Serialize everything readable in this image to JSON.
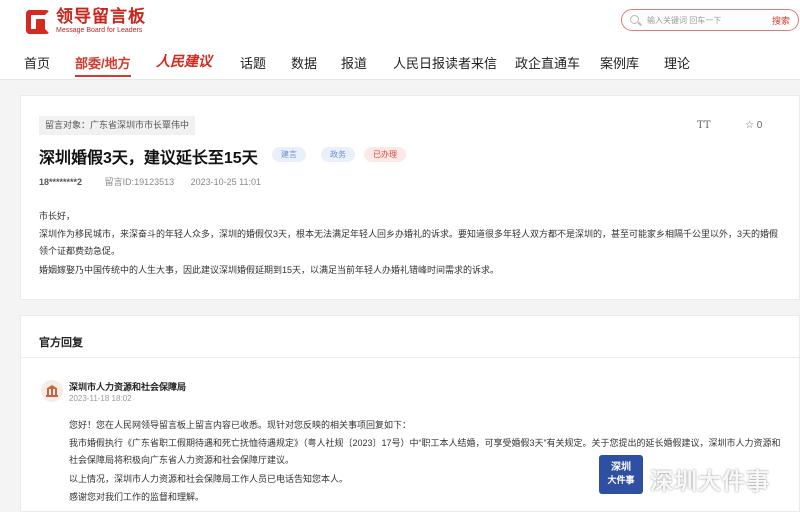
{
  "header": {
    "logo_title": "领导留言板",
    "logo_subtitle": "Message Board for Leaders",
    "search_placeholder": "输入关键词 回车一下",
    "search_button": "搜索"
  },
  "nav": {
    "items": [
      "首页",
      "部委/地方",
      "人民建议",
      "话题",
      "数据",
      "报道",
      "人民日报读者来信",
      "政企直通车",
      "案例库",
      "理论"
    ],
    "active_index": 1
  },
  "message": {
    "target": "留言对象：广东省深圳市市长覃伟中",
    "font_toggle": "TT",
    "star": "☆",
    "star_count": "0",
    "title": "深圳婚假3天，建议延长至15天",
    "tags": [
      "建言",
      "政务",
      "已办理"
    ],
    "author": "18********2",
    "message_id": "留言ID:19123513",
    "datetime": "2023-10-25 11:01",
    "paragraphs": [
      "市长好，",
      "深圳作为移民城市，来深奋斗的年轻人众多，深圳的婚假仅3天，根本无法满足年轻人回乡办婚礼的诉求。要知道很多年轻人双方都不是深圳的，甚至可能家乡相隔千公里以外，3天的婚假领个证都费劲急促。",
      "婚姻嫁娶乃中国传统中的人生大事，因此建议深圳婚假延期到15天，以满足当前年轻人办婚礼错峰时间需求的诉求。"
    ]
  },
  "reply": {
    "heading": "官方回复",
    "department": "深圳市人力资源和社会保障局",
    "datetime": "2023-11-18 18:02",
    "paragraphs": [
      "您好！您在人民网领导留言板上留言内容已收悉。现针对您反映的相关事项回复如下：",
      "我市婚假执行《广东省职工假期待遇和死亡抚恤待遇规定》（粤人社规〔2023〕17号）中“职工本人结婚，可享受婚假3天”有关规定。关于您提出的延长婚假建议，深圳市人力资源和社会保障局将积极向广东省人力资源和社会保障厅建议。",
      "以上情况，深圳市人力资源和社会保障局工作人员已电话告知您本人。",
      "感谢您对我们工作的监督和理解。"
    ]
  },
  "watermark": {
    "badge_line1": "深圳",
    "badge_line2": "大件事",
    "text": "深圳大件事"
  }
}
